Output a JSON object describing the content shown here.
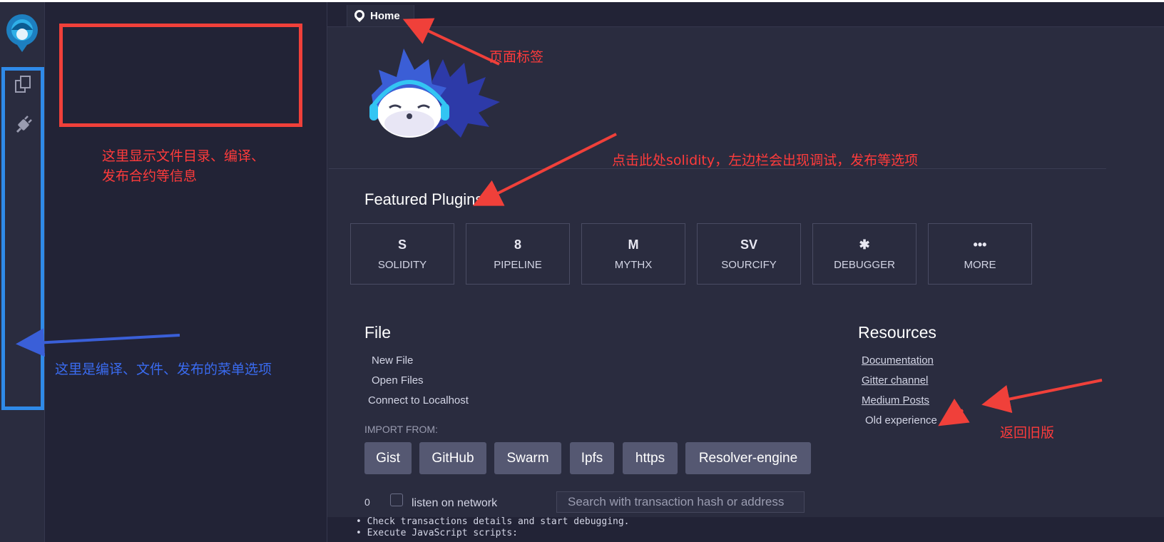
{
  "tab": {
    "home_label": "Home"
  },
  "featured": {
    "title": "Featured Plugins",
    "plugins": [
      {
        "label": "SOLIDITY",
        "glyph": "S"
      },
      {
        "label": "PIPELINE",
        "glyph": "8"
      },
      {
        "label": "MYTHX",
        "glyph": "M"
      },
      {
        "label": "SOURCIFY",
        "glyph": "SV"
      },
      {
        "label": "DEBUGGER",
        "glyph": "✱"
      },
      {
        "label": "MORE",
        "glyph": "•••"
      }
    ]
  },
  "file": {
    "title": "File",
    "new_file": "New File",
    "open_files": "Open Files",
    "connect": "Connect to Localhost",
    "import_label": "IMPORT FROM:",
    "import_buttons": [
      "Gist",
      "GitHub",
      "Swarm",
      "Ipfs",
      "https",
      "Resolver-engine"
    ]
  },
  "resources": {
    "title": "Resources",
    "documentation": "Documentation",
    "gitter": "Gitter channel",
    "medium": "Medium Posts",
    "old": "Old experience"
  },
  "terminal": {
    "count": "0",
    "listen_label": "listen on network",
    "search_placeholder": "Search with transaction hash or address",
    "lines": [
      "• Check transactions details and start debugging.",
      "• Execute JavaScript scripts:"
    ]
  },
  "annotations": {
    "page_tab": "页面标签",
    "side_panel_line1": "这里显示文件目录、编译、",
    "side_panel_line2": "发布合约等信息",
    "solidity_hint": "点击此处solidity，左边栏会出现调试，发布等选项",
    "menu_hint": "这里是编译、文件、发布的菜单选项",
    "old_hint": "返回旧版"
  },
  "icons": {
    "logo": "remix-logo-icon",
    "file_explorer": "file-explorer-icon",
    "plugin_manager": "plugin-plug-icon"
  },
  "colors": {
    "annotation_red": "#f0403a",
    "annotation_blue": "#2f8ae8",
    "background": "#2a2c3f"
  }
}
